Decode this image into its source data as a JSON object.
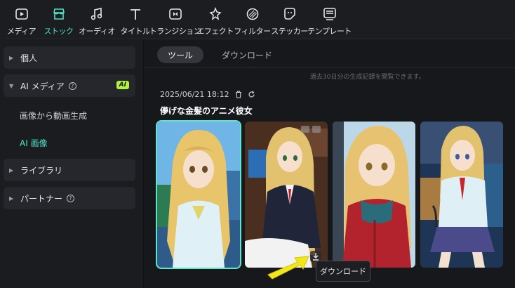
{
  "toolbar": {
    "items": [
      {
        "label": "メディア",
        "icon": "media-icon"
      },
      {
        "label": "ストック",
        "icon": "stock-icon"
      },
      {
        "label": "オーディオ",
        "icon": "audio-icon"
      },
      {
        "label": "タイトル",
        "icon": "title-icon"
      },
      {
        "label": "トランジション",
        "icon": "transition-icon"
      },
      {
        "label": "エフェクト",
        "icon": "effect-icon"
      },
      {
        "label": "フィルター",
        "icon": "filter-icon"
      },
      {
        "label": "ステッカー",
        "icon": "sticker-icon"
      },
      {
        "label": "テンプレート",
        "icon": "template-icon"
      }
    ],
    "active_index": 1,
    "accent": "#4fe0c4"
  },
  "sidebar": {
    "personal": "個人",
    "ai_media": "AI メディア",
    "ai_badge": "AI",
    "sub_image_to_video": "画像から動画生成",
    "sub_ai_image": "AI 画像",
    "library": "ライブラリ",
    "partner": "パートナー"
  },
  "main": {
    "tab_tool": "ツール",
    "tab_download": "ダウンロード",
    "history_note": "過去30日分の生成記録を閲覧できます。",
    "entry_time": "2025/06/21 18:12",
    "prompt": "儚げな金髪のアニメ彼女",
    "image_count": 4,
    "tooltip": "ダウンロード"
  }
}
